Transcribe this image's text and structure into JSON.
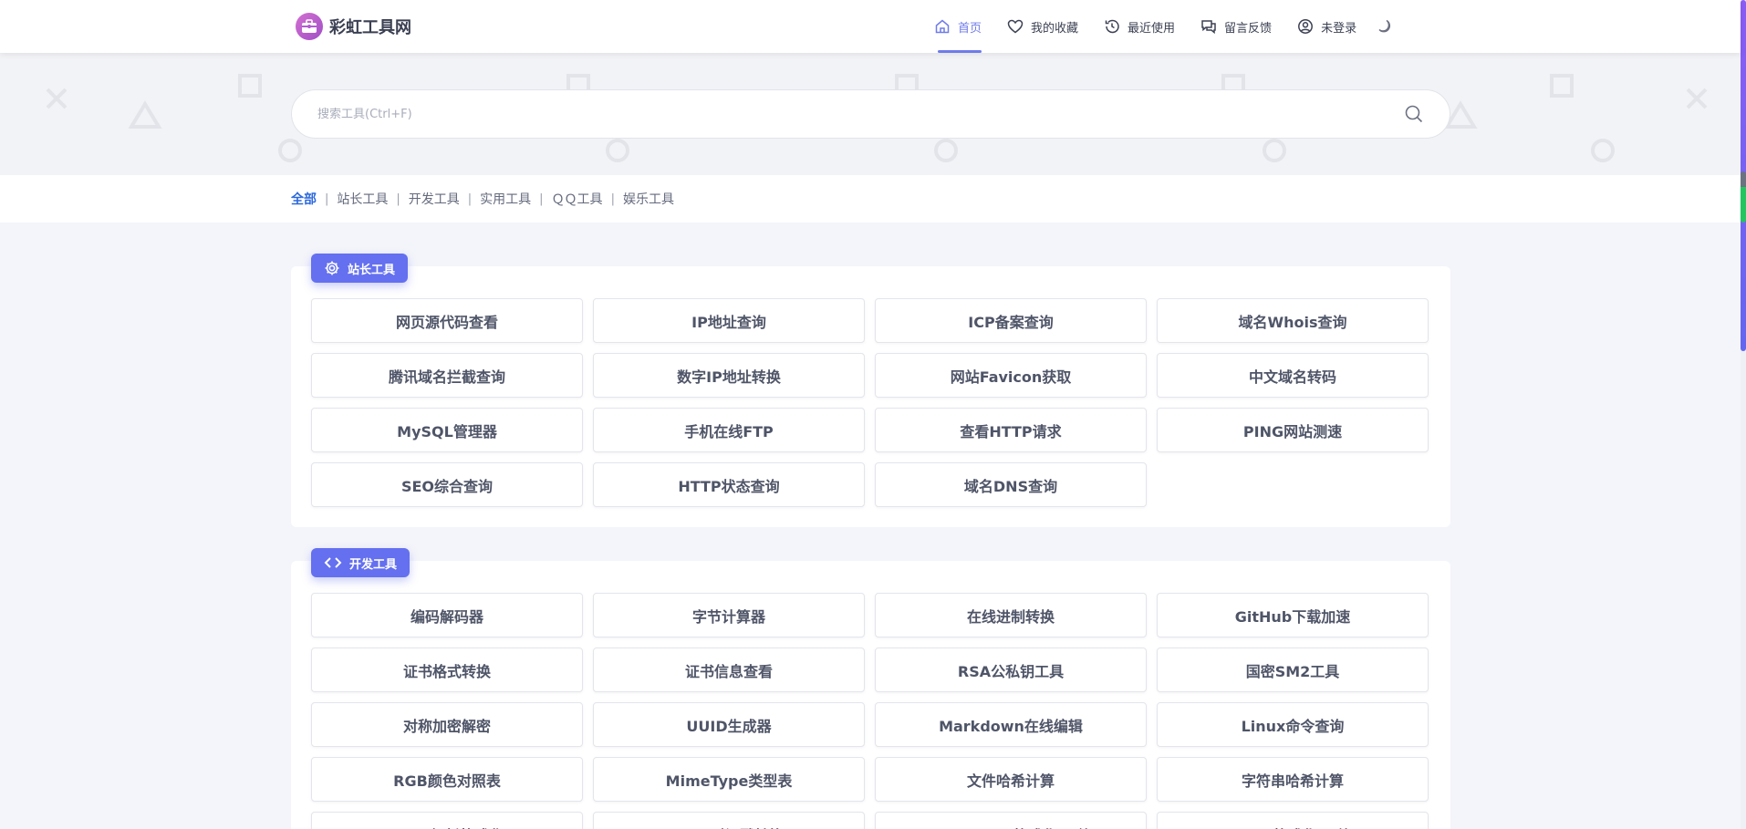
{
  "header": {
    "logo_text": "彩虹工具网",
    "nav": [
      {
        "label": "首页",
        "icon": "home-icon",
        "active": true
      },
      {
        "label": "我的收藏",
        "icon": "heart-icon",
        "active": false
      },
      {
        "label": "最近使用",
        "icon": "history-icon",
        "active": false
      },
      {
        "label": "留言反馈",
        "icon": "chat-icon",
        "active": false
      },
      {
        "label": "未登录",
        "icon": "user-icon",
        "active": false
      }
    ],
    "theme_icon": "moon-icon"
  },
  "search": {
    "placeholder": "搜索工具(Ctrl+F)",
    "value": ""
  },
  "categories": {
    "items": [
      "全部",
      "站长工具",
      "开发工具",
      "实用工具",
      "ＱＱ工具",
      "娱乐工具"
    ],
    "active": "全部"
  },
  "sections": [
    {
      "title": "站长工具",
      "icon": "gear-icon",
      "tools": [
        "网页源代码查看",
        "IP地址查询",
        "ICP备案查询",
        "域名Whois查询",
        "腾讯域名拦截查询",
        "数字IP地址转换",
        "网站Favicon获取",
        "中文域名转码",
        "MySQL管理器",
        "手机在线FTP",
        "查看HTTP请求",
        "PING网站测速",
        "SEO综合查询",
        "HTTP状态查询",
        "域名DNS查询"
      ]
    },
    {
      "title": "开发工具",
      "icon": "code-icon",
      "tools": [
        "编码解码器",
        "字节计算器",
        "在线进制转换",
        "GitHub下载加速",
        "证书格式转换",
        "证书信息查看",
        "RSA公私钥工具",
        "国密SM2工具",
        "对称加密解密",
        "UUID生成器",
        "Markdown在线编辑",
        "Linux命令查询",
        "RGB颜色对照表",
        "MimeType类型表",
        "文件哈希计算",
        "字符串哈希计算",
        "JSON解析格式化",
        "Unix时间戳转换",
        "JavaScript格式化/压缩",
        "Html格式化/压缩"
      ]
    }
  ],
  "colors": {
    "accent": "#6470ef",
    "active_nav": "#6f7bea",
    "active_category": "#2c69dc"
  }
}
